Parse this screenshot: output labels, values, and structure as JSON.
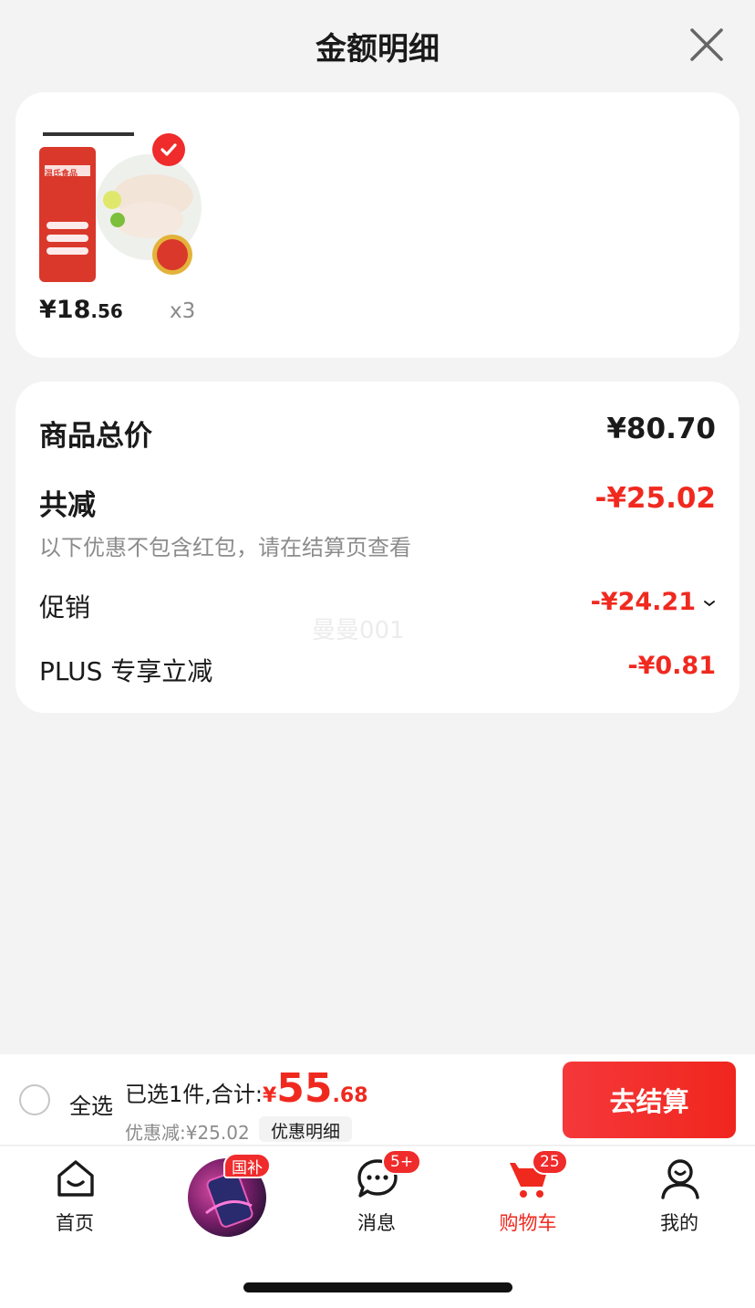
{
  "header": {
    "title": "金额明细"
  },
  "product": {
    "price_main": "¥18",
    "price_decimal": ".56",
    "quantity": "x3",
    "image_brand_text": "温氏食品",
    "selected": true
  },
  "summary": {
    "total_label": "商品总价",
    "total_value": "¥80.70",
    "reduce_label": "共减",
    "reduce_value": "-¥25.02",
    "note": "以下优惠不包含红包，请在结算页查看",
    "promo_label": "促销",
    "promo_value": "-¥24.21",
    "plus_label": "PLUS 专享立减",
    "plus_value": "-¥0.81",
    "watermark": "曼曼001"
  },
  "checkout": {
    "select_all_label": "全选",
    "selected_text": "已选1件,合计:",
    "currency": "¥",
    "amount_main": "55",
    "amount_decimal": ".68",
    "discount_text": "优惠减:¥25.02",
    "detail_label": "优惠明细",
    "button_label": "去结算"
  },
  "tabbar": {
    "home": "首页",
    "promo_badge": "国补",
    "messages": "消息",
    "messages_badge": "5+",
    "cart": "购物车",
    "cart_badge": "25",
    "me": "我的"
  },
  "colors": {
    "accent": "#f0291f",
    "background": "#f3f3f3"
  }
}
